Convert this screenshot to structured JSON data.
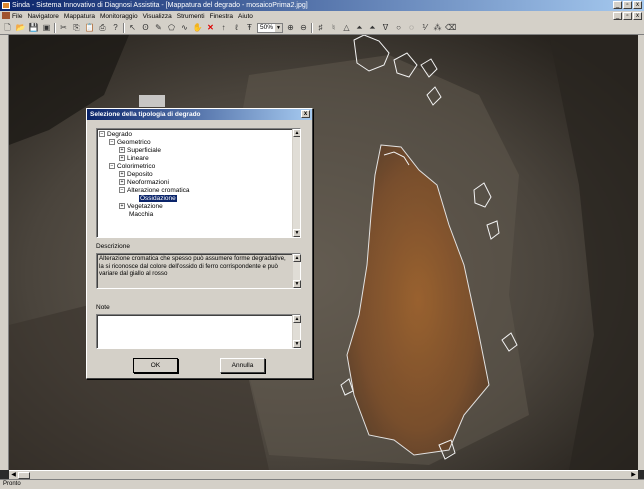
{
  "window": {
    "title": "Sinda - Sistema Innovativo di Diagnosi Assistita - [Mappatura del degrado - mosaicoPrima2.jpg]",
    "min_btn": "_",
    "max_btn": "▫",
    "close_btn": "x"
  },
  "menu": [
    "File",
    "Navigatore",
    "Mappatura",
    "Monitoraggio",
    "Visualizza",
    "Strumenti",
    "Finestra",
    "Aiuto"
  ],
  "toolbar": {
    "zoom_value": "50%"
  },
  "dialog": {
    "title": "Selezione della tipologia di degrado",
    "close": "x",
    "tree": [
      {
        "label": "Degrado",
        "toggle": "−",
        "level": 0
      },
      {
        "label": "Geometrico",
        "toggle": "−",
        "level": 1
      },
      {
        "label": "Superficiale",
        "toggle": "+",
        "level": 2
      },
      {
        "label": "Lineare",
        "toggle": "+",
        "level": 2
      },
      {
        "label": "Colorimetrico",
        "toggle": "−",
        "level": 1
      },
      {
        "label": "Deposito",
        "toggle": "+",
        "level": 2
      },
      {
        "label": "Neoformazioni",
        "toggle": "+",
        "level": 2
      },
      {
        "label": "Alterazione cromatica",
        "toggle": "−",
        "level": 2
      },
      {
        "label": "Ossidazione",
        "toggle": "",
        "level": 3,
        "selected": true
      },
      {
        "label": "Vegetazione",
        "toggle": "+",
        "level": 2
      },
      {
        "label": "Macchia",
        "toggle": "",
        "level": 2
      }
    ],
    "description_label": "Descrizione",
    "description_text": "Alterazione cromatica che spesso può assumere forme degradative, la si riconosce dal colore dell'ossido di ferro corrispondente e può variare dal giallo al rosso",
    "notes_label": "Note",
    "notes_text": "",
    "ok_label": "OK",
    "cancel_label": "Annulla"
  },
  "status": {
    "text": "Pronto"
  }
}
